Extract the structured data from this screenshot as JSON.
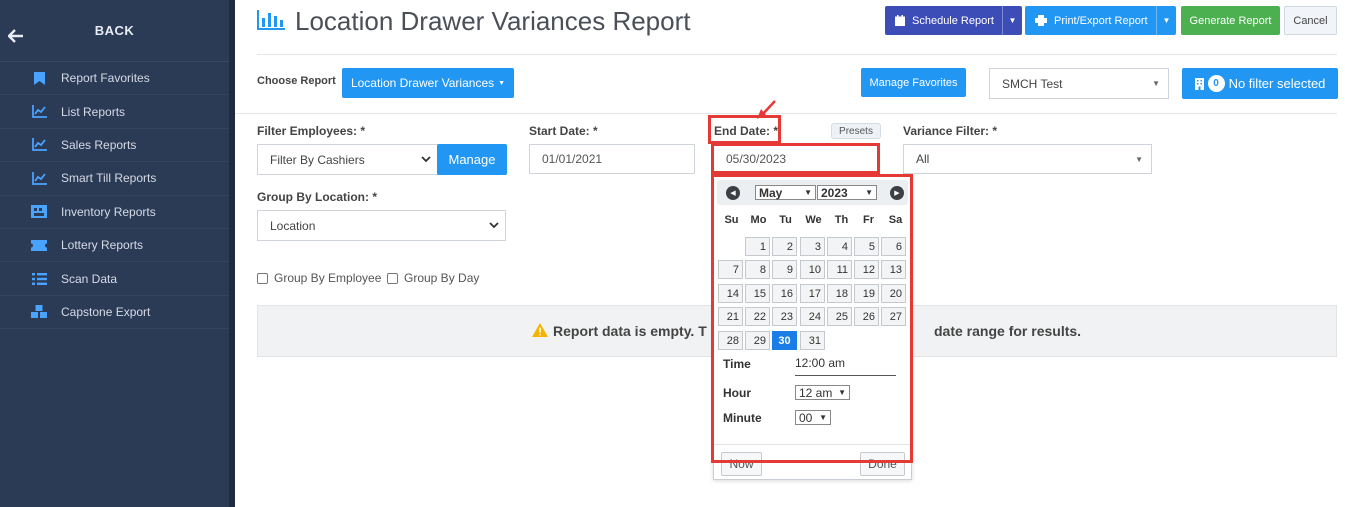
{
  "sidebar": {
    "back_label": "BACK",
    "items": [
      {
        "label": "Report Favorites",
        "icon": "bookmark-icon"
      },
      {
        "label": "List Reports",
        "icon": "line-chart-icon"
      },
      {
        "label": "Sales Reports",
        "icon": "line-chart-icon"
      },
      {
        "label": "Smart Till Reports",
        "icon": "line-chart-icon"
      },
      {
        "label": "Inventory Reports",
        "icon": "inventory-icon"
      },
      {
        "label": "Lottery Reports",
        "icon": "ticket-icon"
      },
      {
        "label": "Scan Data",
        "icon": "list-icon"
      },
      {
        "label": "Capstone Export",
        "icon": "cubes-icon"
      }
    ]
  },
  "header": {
    "title": "Location Drawer Variances Report",
    "schedule_label": "Schedule Report",
    "print_label": "Print/Export Report",
    "generate_label": "Generate Report",
    "cancel_label": "Cancel"
  },
  "toolbar": {
    "choose_report_label": "Choose Report",
    "choose_report_value": "Location Drawer Variances",
    "manage_favorites_label": "Manage Favorites",
    "store_value": "SMCH Test",
    "filter_count": "0",
    "filter_label": "No filter selected"
  },
  "form": {
    "filter_employees_label": "Filter Employees: *",
    "filter_employees_value": "Filter By Cashiers",
    "manage_label": "Manage",
    "start_date_label": "Start Date: *",
    "start_date_value": "01/01/2021",
    "end_date_label": "End Date: *",
    "end_date_value": "05/30/2023",
    "presets_label": "Presets",
    "variance_filter_label": "Variance Filter: *",
    "variance_filter_value": "All",
    "group_by_location_label": "Group By Location: *",
    "group_by_location_value": "Location",
    "group_by_employee_label": "Group By Employee",
    "group_by_day_label": "Group By Day"
  },
  "alert": {
    "text_left": "Report data is empty. T",
    "text_right": "date range for results."
  },
  "datepicker": {
    "month": "May",
    "year": "2023",
    "weekdays": [
      "Su",
      "Mo",
      "Tu",
      "We",
      "Th",
      "Fr",
      "Sa"
    ],
    "days": [
      "1",
      "2",
      "3",
      "4",
      "5",
      "6",
      "7",
      "8",
      "9",
      "10",
      "11",
      "12",
      "13",
      "14",
      "15",
      "16",
      "17",
      "18",
      "19",
      "20",
      "21",
      "22",
      "23",
      "24",
      "25",
      "26",
      "27",
      "28",
      "29",
      "30",
      "31"
    ],
    "selected_day": "30",
    "time_label": "Time",
    "time_value": "12:00 am",
    "hour_label": "Hour",
    "hour_value": "12 am",
    "minute_label": "Minute",
    "minute_value": "00",
    "now_label": "Now",
    "done_label": "Done"
  },
  "colors": {
    "sidebar_bg": "#2b3a55",
    "primary": "#2196f3",
    "schedule": "#3d4db7",
    "generate": "#4caf50",
    "highlight": "#e53935"
  }
}
